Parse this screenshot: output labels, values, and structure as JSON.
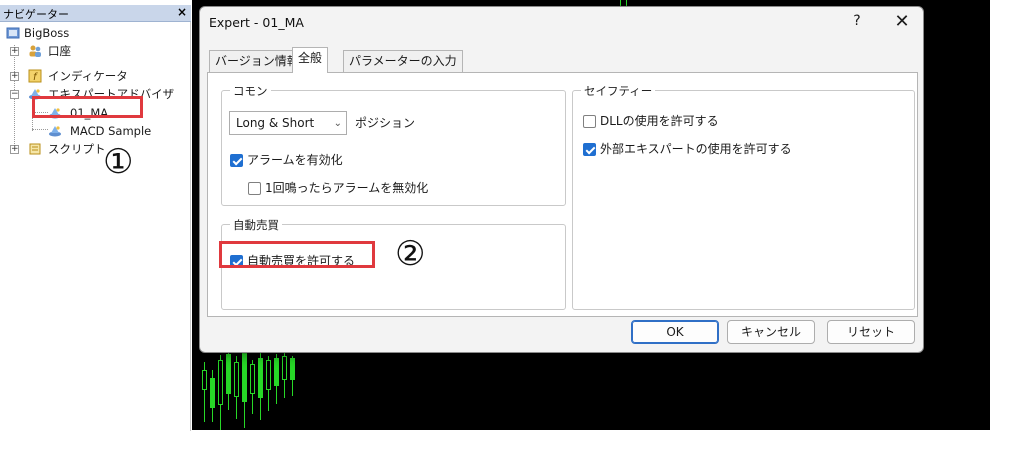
{
  "navigator": {
    "title": "ナビゲーター",
    "close": "×",
    "items": [
      {
        "label": "BigBoss",
        "icon": "account-folder-icon"
      },
      {
        "label": "口座",
        "icon": "people-icon"
      },
      {
        "label": "インディケータ",
        "icon": "indicator-icon"
      },
      {
        "label": "エキスパートアドバイザ",
        "icon": "expert-hat-icon"
      },
      {
        "label": "01_MA",
        "icon": "expert-hat-icon"
      },
      {
        "label": "MACD Sample",
        "icon": "expert-hat-icon"
      },
      {
        "label": "スクリプト",
        "icon": "script-icon"
      }
    ],
    "annotation": "①"
  },
  "dialog": {
    "title": "Expert - 01_MA",
    "help": "?",
    "close": "✕",
    "tabs": [
      {
        "label": "バージョン情報",
        "active": false
      },
      {
        "label": "全般",
        "active": true
      },
      {
        "label": "パラメーターの入力",
        "active": false
      }
    ],
    "common": {
      "group_label": "コモン",
      "position_value": "Long & Short",
      "position_label": "ポジション",
      "enable_alerts": {
        "label": "アラームを有効化",
        "checked": true
      },
      "disable_after_one": {
        "label": "1回鳴ったらアラームを無効化",
        "checked": false
      }
    },
    "auto_trade": {
      "group_label": "自動売買",
      "allow": {
        "label": "自動売買を許可する",
        "checked": true
      }
    },
    "safety": {
      "group_label": "セイフティー",
      "allow_dll": {
        "label": "DLLの使用を許可する",
        "checked": false
      },
      "allow_external_experts": {
        "label": "外部エキスパートの使用を許可する",
        "checked": true
      }
    },
    "buttons": {
      "ok": "OK",
      "cancel": "キャンセル",
      "reset": "リセット"
    },
    "annotation": "②"
  },
  "colors": {
    "accent": "#1f6fd1",
    "highlight_box": "#e0393e",
    "candle": "#27d827",
    "chart_background": "#000000"
  }
}
